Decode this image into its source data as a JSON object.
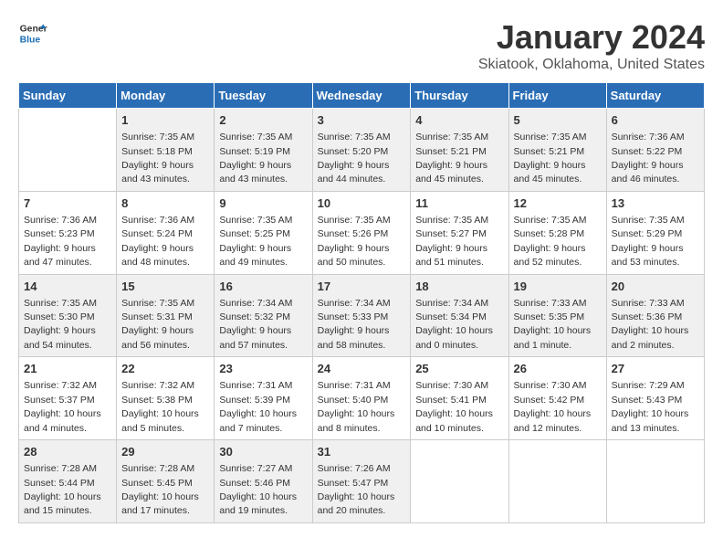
{
  "logo": {
    "text_general": "General",
    "text_blue": "Blue"
  },
  "title": "January 2024",
  "subtitle": "Skiatook, Oklahoma, United States",
  "weekdays": [
    "Sunday",
    "Monday",
    "Tuesday",
    "Wednesday",
    "Thursday",
    "Friday",
    "Saturday"
  ],
  "weeks": [
    [
      {
        "day": "",
        "sunrise": "",
        "sunset": "",
        "daylight": ""
      },
      {
        "day": "1",
        "sunrise": "Sunrise: 7:35 AM",
        "sunset": "Sunset: 5:18 PM",
        "daylight": "Daylight: 9 hours and 43 minutes."
      },
      {
        "day": "2",
        "sunrise": "Sunrise: 7:35 AM",
        "sunset": "Sunset: 5:19 PM",
        "daylight": "Daylight: 9 hours and 43 minutes."
      },
      {
        "day": "3",
        "sunrise": "Sunrise: 7:35 AM",
        "sunset": "Sunset: 5:20 PM",
        "daylight": "Daylight: 9 hours and 44 minutes."
      },
      {
        "day": "4",
        "sunrise": "Sunrise: 7:35 AM",
        "sunset": "Sunset: 5:21 PM",
        "daylight": "Daylight: 9 hours and 45 minutes."
      },
      {
        "day": "5",
        "sunrise": "Sunrise: 7:35 AM",
        "sunset": "Sunset: 5:21 PM",
        "daylight": "Daylight: 9 hours and 45 minutes."
      },
      {
        "day": "6",
        "sunrise": "Sunrise: 7:36 AM",
        "sunset": "Sunset: 5:22 PM",
        "daylight": "Daylight: 9 hours and 46 minutes."
      }
    ],
    [
      {
        "day": "7",
        "sunrise": "Sunrise: 7:36 AM",
        "sunset": "Sunset: 5:23 PM",
        "daylight": "Daylight: 9 hours and 47 minutes."
      },
      {
        "day": "8",
        "sunrise": "Sunrise: 7:36 AM",
        "sunset": "Sunset: 5:24 PM",
        "daylight": "Daylight: 9 hours and 48 minutes."
      },
      {
        "day": "9",
        "sunrise": "Sunrise: 7:35 AM",
        "sunset": "Sunset: 5:25 PM",
        "daylight": "Daylight: 9 hours and 49 minutes."
      },
      {
        "day": "10",
        "sunrise": "Sunrise: 7:35 AM",
        "sunset": "Sunset: 5:26 PM",
        "daylight": "Daylight: 9 hours and 50 minutes."
      },
      {
        "day": "11",
        "sunrise": "Sunrise: 7:35 AM",
        "sunset": "Sunset: 5:27 PM",
        "daylight": "Daylight: 9 hours and 51 minutes."
      },
      {
        "day": "12",
        "sunrise": "Sunrise: 7:35 AM",
        "sunset": "Sunset: 5:28 PM",
        "daylight": "Daylight: 9 hours and 52 minutes."
      },
      {
        "day": "13",
        "sunrise": "Sunrise: 7:35 AM",
        "sunset": "Sunset: 5:29 PM",
        "daylight": "Daylight: 9 hours and 53 minutes."
      }
    ],
    [
      {
        "day": "14",
        "sunrise": "Sunrise: 7:35 AM",
        "sunset": "Sunset: 5:30 PM",
        "daylight": "Daylight: 9 hours and 54 minutes."
      },
      {
        "day": "15",
        "sunrise": "Sunrise: 7:35 AM",
        "sunset": "Sunset: 5:31 PM",
        "daylight": "Daylight: 9 hours and 56 minutes."
      },
      {
        "day": "16",
        "sunrise": "Sunrise: 7:34 AM",
        "sunset": "Sunset: 5:32 PM",
        "daylight": "Daylight: 9 hours and 57 minutes."
      },
      {
        "day": "17",
        "sunrise": "Sunrise: 7:34 AM",
        "sunset": "Sunset: 5:33 PM",
        "daylight": "Daylight: 9 hours and 58 minutes."
      },
      {
        "day": "18",
        "sunrise": "Sunrise: 7:34 AM",
        "sunset": "Sunset: 5:34 PM",
        "daylight": "Daylight: 10 hours and 0 minutes."
      },
      {
        "day": "19",
        "sunrise": "Sunrise: 7:33 AM",
        "sunset": "Sunset: 5:35 PM",
        "daylight": "Daylight: 10 hours and 1 minute."
      },
      {
        "day": "20",
        "sunrise": "Sunrise: 7:33 AM",
        "sunset": "Sunset: 5:36 PM",
        "daylight": "Daylight: 10 hours and 2 minutes."
      }
    ],
    [
      {
        "day": "21",
        "sunrise": "Sunrise: 7:32 AM",
        "sunset": "Sunset: 5:37 PM",
        "daylight": "Daylight: 10 hours and 4 minutes."
      },
      {
        "day": "22",
        "sunrise": "Sunrise: 7:32 AM",
        "sunset": "Sunset: 5:38 PM",
        "daylight": "Daylight: 10 hours and 5 minutes."
      },
      {
        "day": "23",
        "sunrise": "Sunrise: 7:31 AM",
        "sunset": "Sunset: 5:39 PM",
        "daylight": "Daylight: 10 hours and 7 minutes."
      },
      {
        "day": "24",
        "sunrise": "Sunrise: 7:31 AM",
        "sunset": "Sunset: 5:40 PM",
        "daylight": "Daylight: 10 hours and 8 minutes."
      },
      {
        "day": "25",
        "sunrise": "Sunrise: 7:30 AM",
        "sunset": "Sunset: 5:41 PM",
        "daylight": "Daylight: 10 hours and 10 minutes."
      },
      {
        "day": "26",
        "sunrise": "Sunrise: 7:30 AM",
        "sunset": "Sunset: 5:42 PM",
        "daylight": "Daylight: 10 hours and 12 minutes."
      },
      {
        "day": "27",
        "sunrise": "Sunrise: 7:29 AM",
        "sunset": "Sunset: 5:43 PM",
        "daylight": "Daylight: 10 hours and 13 minutes."
      }
    ],
    [
      {
        "day": "28",
        "sunrise": "Sunrise: 7:28 AM",
        "sunset": "Sunset: 5:44 PM",
        "daylight": "Daylight: 10 hours and 15 minutes."
      },
      {
        "day": "29",
        "sunrise": "Sunrise: 7:28 AM",
        "sunset": "Sunset: 5:45 PM",
        "daylight": "Daylight: 10 hours and 17 minutes."
      },
      {
        "day": "30",
        "sunrise": "Sunrise: 7:27 AM",
        "sunset": "Sunset: 5:46 PM",
        "daylight": "Daylight: 10 hours and 19 minutes."
      },
      {
        "day": "31",
        "sunrise": "Sunrise: 7:26 AM",
        "sunset": "Sunset: 5:47 PM",
        "daylight": "Daylight: 10 hours and 20 minutes."
      },
      {
        "day": "",
        "sunrise": "",
        "sunset": "",
        "daylight": ""
      },
      {
        "day": "",
        "sunrise": "",
        "sunset": "",
        "daylight": ""
      },
      {
        "day": "",
        "sunrise": "",
        "sunset": "",
        "daylight": ""
      }
    ]
  ]
}
